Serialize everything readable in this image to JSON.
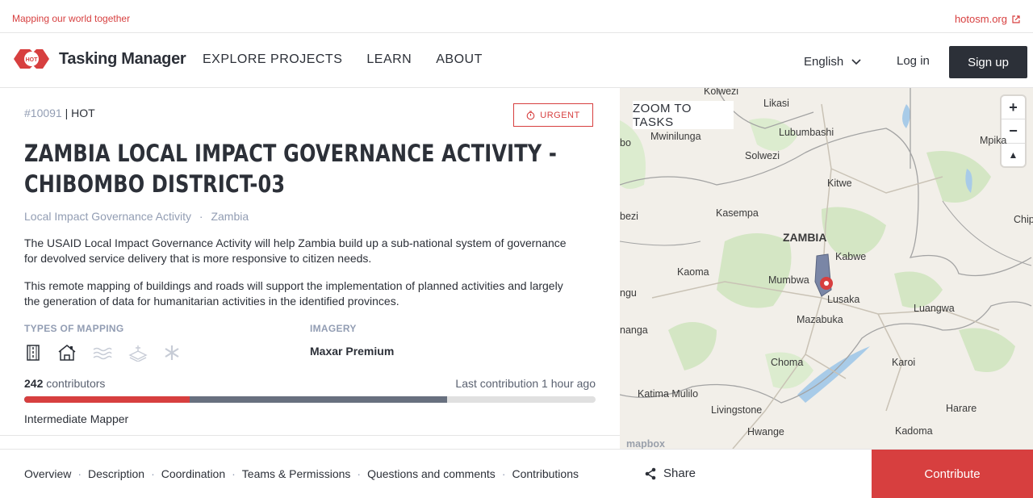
{
  "topbar": {
    "tagline": "Mapping our world together",
    "external_link": "hotosm.org"
  },
  "nav": {
    "logo_text": "Tasking Manager",
    "logo_badge": "HOT",
    "links": [
      "EXPLORE PROJECTS",
      "LEARN",
      "ABOUT"
    ],
    "language": "English",
    "login": "Log in",
    "signup": "Sign up"
  },
  "project": {
    "id": "#10091",
    "org": "| HOT",
    "priority": "URGENT",
    "title": "ZAMBIA LOCAL IMPACT GOVERNANCE ACTIVITY - CHIBOMBO DISTRICT-03",
    "campaign": "Local Impact Governance Activity",
    "campaign_sep": "·",
    "country": "Zambia",
    "description_1": "The USAID Local Impact Governance Activity will help Zambia build up a sub-national system of governance for devolved service delivery that is more responsive to citizen needs.",
    "description_2": "This remote mapping of buildings and roads will support the implementation of planned activities and largely the generation of data for humanitarian activities in the identified provinces.",
    "types_label": "TYPES OF MAPPING",
    "mapping_types": [
      "roads-icon",
      "buildings-icon",
      "waterways-icon",
      "landuse-icon",
      "other-icon"
    ],
    "imagery_label": "IMAGERY",
    "imagery": "Maxar Premium",
    "contributors_count": "242",
    "contributors_text": " contributors",
    "last_contribution": "Last contribution 1 hour ago",
    "mapped_fraction": 0.29,
    "validated_fraction": 0.74,
    "mapper_level": "Intermediate Mapper",
    "colors": {
      "accent": "#d73f3f",
      "dark": "#2c3038",
      "muted": "#929db3"
    }
  },
  "map": {
    "zoom_button": "ZOOM TO TASKS",
    "controls": [
      "+",
      "−",
      "▲"
    ],
    "places": [
      "Kolwezi",
      "Likasi",
      "Lubumbashi",
      "Mwinilunga",
      "Solwezi",
      "Mpika",
      "Kitwe",
      "Kasempa",
      "ZAMBIA",
      "Kabwe",
      "Kaoma",
      "Mumbwa",
      "Lusaka",
      "Mazabuka",
      "Luangwa",
      "Choma",
      "Karoi",
      "Katima Mulilo",
      "Livingstone",
      "Harare",
      "Hwange",
      "Kadoma",
      "bo",
      "bezi",
      "ngu",
      "nanga",
      "Chip"
    ],
    "attribution": "mapbox"
  },
  "bottom": {
    "tabs": [
      "Overview",
      "Description",
      "Coordination",
      "Teams & Permissions",
      "Questions and comments",
      "Contributions"
    ],
    "share": "Share",
    "contribute": "Contribute"
  }
}
